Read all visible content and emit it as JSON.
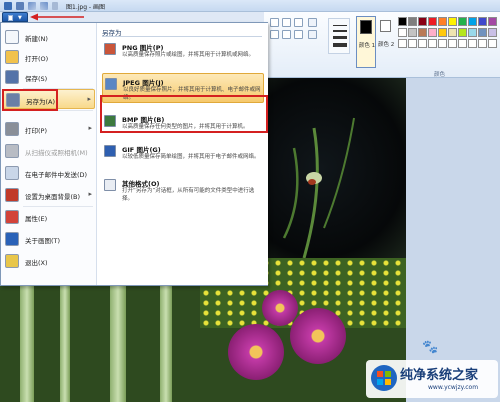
{
  "window": {
    "title": "图1.jpg - 画图"
  },
  "file_menu": {
    "items": [
      {
        "label": "新建(N)",
        "icon": "new-doc-icon"
      },
      {
        "label": "打开(O)",
        "icon": "open-folder-icon"
      },
      {
        "label": "保存(S)",
        "icon": "save-icon"
      },
      {
        "label": "另存为(A)",
        "icon": "save-as-icon",
        "has_submenu": true,
        "highlighted": true
      },
      {
        "label": "打印(P)",
        "icon": "print-icon",
        "has_submenu": true
      },
      {
        "label": "从扫描仪或照相机(M)",
        "icon": "scanner-icon",
        "disabled": true
      },
      {
        "label": "在电子邮件中发送(D)",
        "icon": "email-icon"
      },
      {
        "label": "设置为桌面背景(B)",
        "icon": "desktop-background-icon",
        "has_submenu": true
      },
      {
        "label": "属性(E)",
        "icon": "properties-check-icon"
      },
      {
        "label": "关于画图(T)",
        "icon": "info-icon"
      },
      {
        "label": "退出(X)",
        "icon": "exit-icon"
      }
    ]
  },
  "save_as_submenu": {
    "header": "另存为",
    "items": [
      {
        "title": "PNG 图片(P)",
        "desc": "以高质量保存照片或绘图，并将其用于计算机或网络。",
        "icon": "png-image-icon"
      },
      {
        "title": "JPEG 图片(J)",
        "desc": "以良好质量保存照片，并将其用于计算机、电子邮件或网络。",
        "icon": "jpeg-image-icon",
        "highlighted": true
      },
      {
        "title": "BMP 图片(B)",
        "desc": "以高质量保存任何类型的图片，并将其用于计算机。",
        "icon": "bmp-image-icon"
      },
      {
        "title": "GIF 图片(G)",
        "desc": "以较低质量保存简单绘图，并将其用于电子邮件或网络。",
        "icon": "gif-image-icon"
      },
      {
        "title": "其他格式(O)",
        "desc": "打开“另存为”对话框，从所有可能的文件类型中进行选择。",
        "icon": "other-formats-icon"
      }
    ]
  },
  "ribbon": {
    "color1_label": "颜色 1",
    "color2_label": "颜色 2",
    "group_label": "颜色",
    "palette": [
      "#000000",
      "#7f7f7f",
      "#880015",
      "#ed1c24",
      "#ff7f27",
      "#fff200",
      "#22b14c",
      "#00a2e8",
      "#3f48cc",
      "#a349a4",
      "#ffffff",
      "#c3c3c3",
      "#b97a57",
      "#ffaec9",
      "#ffc90e",
      "#efe4b0",
      "#b5e61d",
      "#99d9ea",
      "#7092be",
      "#c8bfe7",
      "#ffffff",
      "#ffffff",
      "#ffffff",
      "#ffffff",
      "#ffffff",
      "#ffffff",
      "#ffffff",
      "#ffffff",
      "#ffffff",
      "#ffffff"
    ],
    "color1": "#000000",
    "color2": "#ffffff"
  },
  "watermark": {
    "title": "纯净系统之家",
    "url": "www.ycwjzy.com"
  },
  "colors": {
    "highlight": "#f8d98b",
    "annotation_red": "#d42020",
    "accent": "#1c56a8"
  }
}
